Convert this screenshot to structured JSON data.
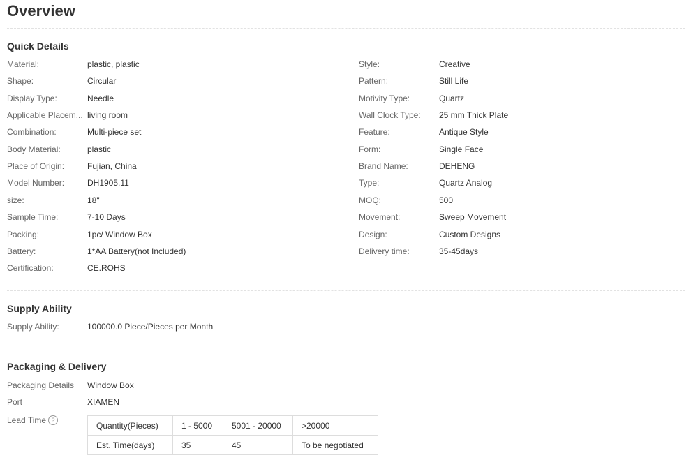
{
  "title": "Overview",
  "quick_details": {
    "heading": "Quick Details",
    "left": [
      {
        "label": "Material:",
        "value": "plastic, plastic"
      },
      {
        "label": "Shape:",
        "value": "Circular"
      },
      {
        "label": "Display Type:",
        "value": "Needle"
      },
      {
        "label": "Applicable Placem...",
        "value": "living room"
      },
      {
        "label": "Combination:",
        "value": "Multi-piece set"
      },
      {
        "label": "Body Material:",
        "value": "plastic"
      },
      {
        "label": "Place of Origin:",
        "value": "Fujian, China"
      },
      {
        "label": "Model Number:",
        "value": "DH1905.11"
      },
      {
        "label": "size:",
        "value": "18\""
      },
      {
        "label": "Sample Time:",
        "value": "7-10 Days"
      },
      {
        "label": "Packing:",
        "value": "1pc/ Window Box"
      },
      {
        "label": "Battery:",
        "value": "1*AA Battery(not Included)"
      },
      {
        "label": "Certification:",
        "value": "CE.ROHS"
      }
    ],
    "right": [
      {
        "label": "Style:",
        "value": "Creative"
      },
      {
        "label": "Pattern:",
        "value": "Still Life"
      },
      {
        "label": "Motivity Type:",
        "value": "Quartz"
      },
      {
        "label": "Wall Clock Type:",
        "value": "25 mm Thick Plate"
      },
      {
        "label": "Feature:",
        "value": "Antique Style"
      },
      {
        "label": "Form:",
        "value": "Single Face"
      },
      {
        "label": "Brand Name:",
        "value": "DEHENG"
      },
      {
        "label": "Type:",
        "value": "Quartz Analog"
      },
      {
        "label": "MOQ:",
        "value": "500"
      },
      {
        "label": "Movement:",
        "value": "Sweep Movement"
      },
      {
        "label": "Design:",
        "value": "Custom Designs"
      },
      {
        "label": "Delivery time:",
        "value": "35-45days"
      }
    ]
  },
  "supply": {
    "heading": "Supply Ability",
    "label": "Supply Ability:",
    "value": "100000.0 Piece/Pieces per Month"
  },
  "packaging": {
    "heading": "Packaging & Delivery",
    "details_label": "Packaging Details",
    "details_value": "Window Box",
    "port_label": "Port",
    "port_value": "XIAMEN",
    "lead_label": "Lead Time",
    "help_glyph": "?",
    "lead_table": {
      "header": [
        "Quantity(Pieces)",
        "1 - 5000",
        "5001 - 20000",
        ">20000"
      ],
      "row": [
        "Est. Time(days)",
        "35",
        "45",
        "To be negotiated"
      ]
    }
  }
}
